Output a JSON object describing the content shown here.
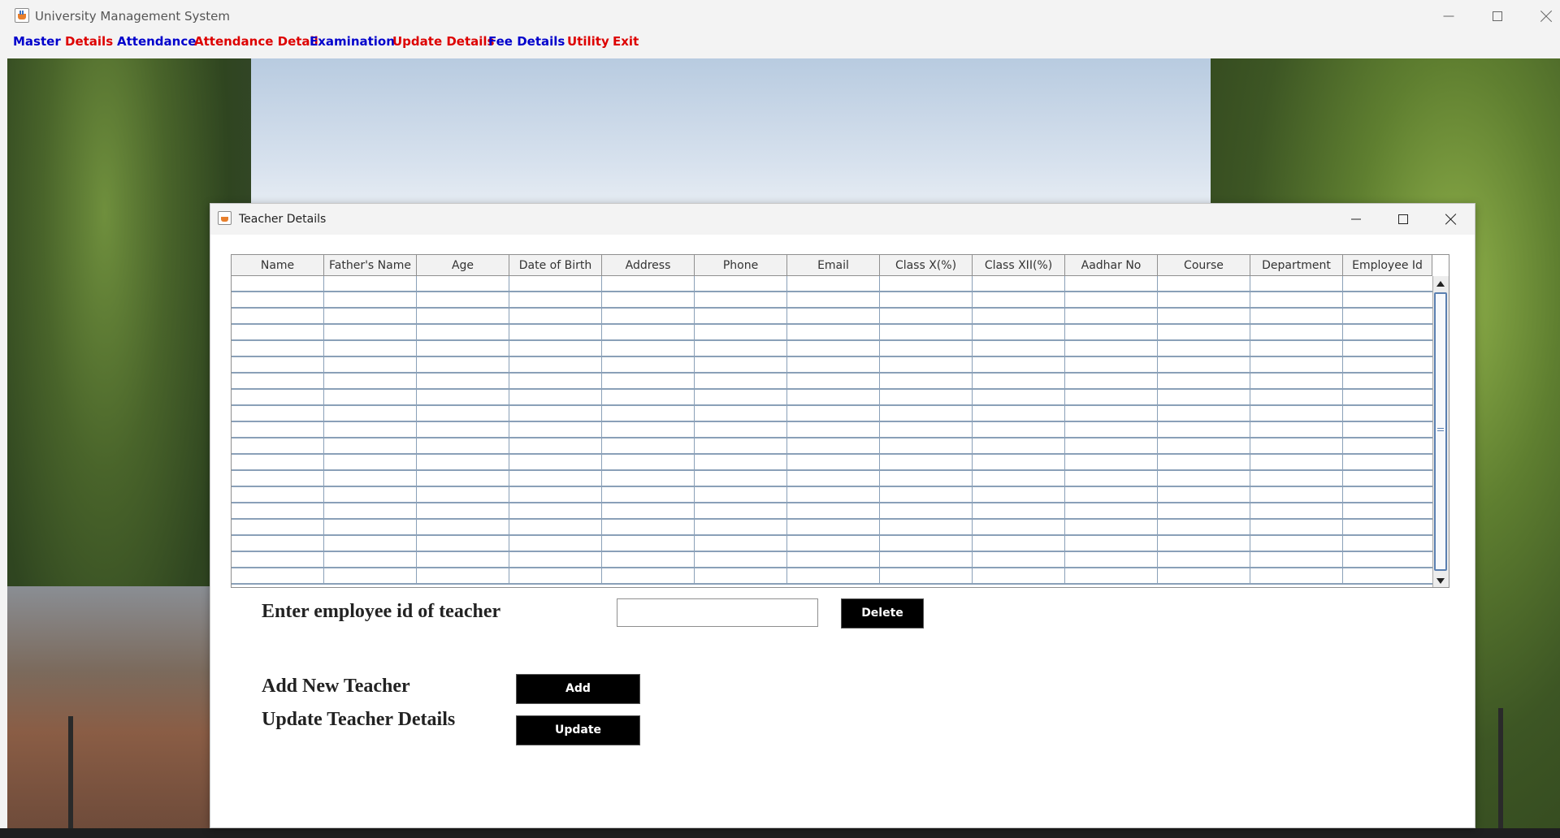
{
  "window": {
    "title": "University Management System"
  },
  "menu": [
    {
      "label": "Master",
      "color": "#0000cc"
    },
    {
      "label": "Details",
      "color": "#dd0000"
    },
    {
      "label": "Attendance",
      "color": "#0000cc"
    },
    {
      "label": "Attendance Detail",
      "color": "#dd0000"
    },
    {
      "label": "Examination",
      "color": "#0000cc"
    },
    {
      "label": "Update Details",
      "color": "#dd0000"
    },
    {
      "label": "Fee Details",
      "color": "#0000cc"
    },
    {
      "label": "Utility",
      "color": "#dd0000"
    },
    {
      "label": "Exit",
      "color": "#dd0000"
    }
  ],
  "dialog": {
    "title": "Teacher Details",
    "table": {
      "columns": [
        "Name",
        "Father's Name",
        "Age",
        "Date of Birth",
        "Address",
        "Phone",
        "Email",
        "Class X(%)",
        "Class XII(%)",
        "Aadhar No",
        "Course",
        "Department",
        "Employee Id"
      ],
      "row_count": 19
    },
    "delete_section": {
      "label": "Enter employee id of teacher",
      "input_value": "",
      "button_label": "Delete"
    },
    "add_section": {
      "label": "Add New Teacher",
      "button_label": "Add"
    },
    "update_section": {
      "label": "Update Teacher Details",
      "button_label": "Update"
    }
  }
}
